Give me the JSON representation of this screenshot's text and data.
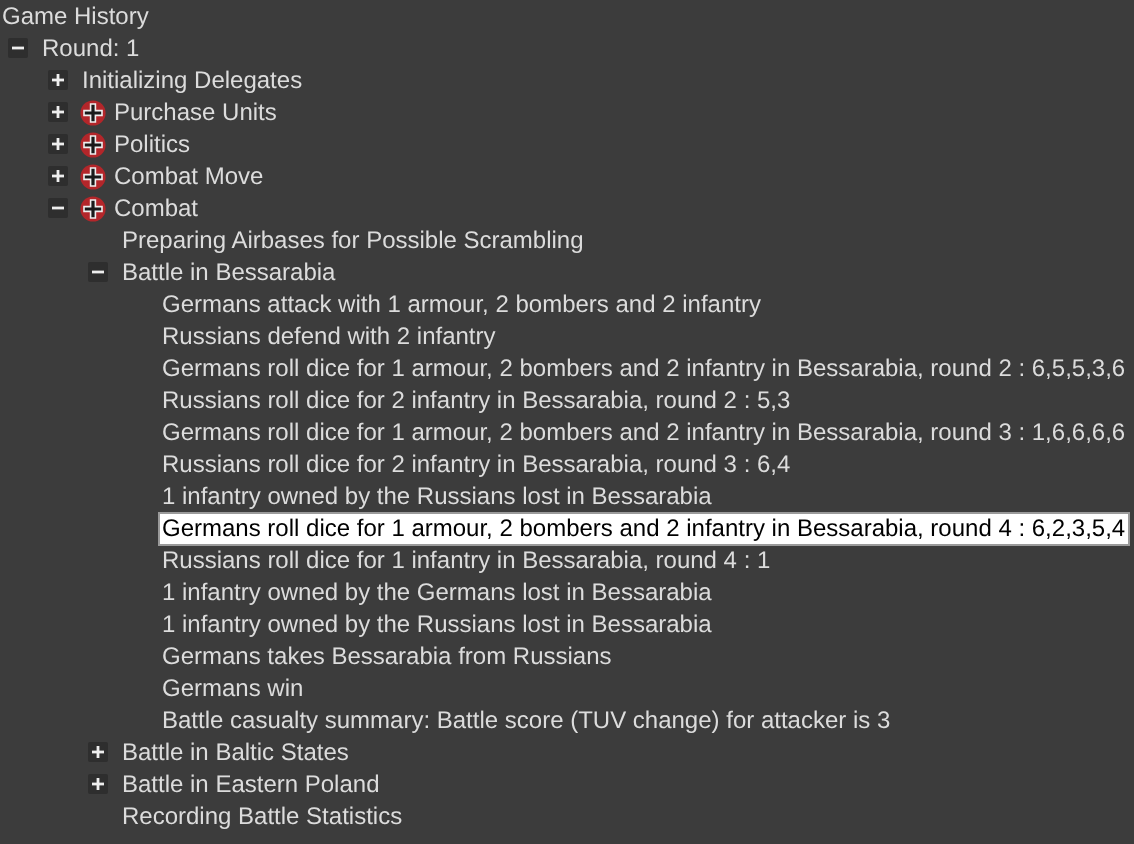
{
  "title": "Game History",
  "tree": [
    {
      "label": "Round: 1",
      "expanded": true,
      "selected": false,
      "children": [
        {
          "label": "Initializing Delegates",
          "expanded": false,
          "selected": false
        },
        {
          "label": "Purchase Units",
          "expanded": false,
          "selected": false,
          "flag": true
        },
        {
          "label": "Politics",
          "expanded": false,
          "selected": false,
          "flag": true
        },
        {
          "label": "Combat Move",
          "expanded": false,
          "selected": false,
          "flag": true
        },
        {
          "label": "Combat",
          "expanded": true,
          "selected": false,
          "flag": true,
          "children": [
            {
              "label": "Preparing Airbases for Possible Scrambling",
              "selected": false
            },
            {
              "label": "Battle in Bessarabia",
              "expanded": true,
              "selected": false,
              "children": [
                {
                  "label": "Germans attack with 1 armour, 2 bombers and 2 infantry",
                  "selected": false
                },
                {
                  "label": "Russians defend with 2 infantry",
                  "selected": false
                },
                {
                  "label": "Germans roll dice for 1 armour, 2 bombers and 2 infantry in Bessarabia, round 2 : 6,5,5,3,6",
                  "selected": false
                },
                {
                  "label": "Russians roll dice for 2 infantry in Bessarabia, round 2 : 5,3",
                  "selected": false
                },
                {
                  "label": "Germans roll dice for 1 armour, 2 bombers and 2 infantry in Bessarabia, round 3 : 1,6,6,6,6",
                  "selected": false
                },
                {
                  "label": "Russians roll dice for 2 infantry in Bessarabia, round 3 : 6,4",
                  "selected": false
                },
                {
                  "label": "1 infantry owned by the Russians lost in Bessarabia",
                  "selected": false
                },
                {
                  "label": "Germans roll dice for 1 armour, 2 bombers and 2 infantry in Bessarabia, round 4 : 6,2,3,5,4",
                  "selected": true
                },
                {
                  "label": "Russians roll dice for 1 infantry in Bessarabia, round 4 : 1",
                  "selected": false
                },
                {
                  "label": "1 infantry owned by the Germans lost in Bessarabia",
                  "selected": false
                },
                {
                  "label": "1 infantry owned by the Russians lost in Bessarabia",
                  "selected": false
                },
                {
                  "label": "Germans takes Bessarabia from Russians",
                  "selected": false
                },
                {
                  "label": "Germans win",
                  "selected": false
                },
                {
                  "label": "Battle casualty summary: Battle score (TUV change) for attacker is 3",
                  "selected": false
                }
              ]
            },
            {
              "label": "Battle in Baltic States",
              "expanded": false,
              "selected": false
            },
            {
              "label": "Battle in Eastern Poland",
              "expanded": false,
              "selected": false
            },
            {
              "label": "Recording Battle Statistics",
              "selected": false
            }
          ]
        }
      ]
    }
  ]
}
